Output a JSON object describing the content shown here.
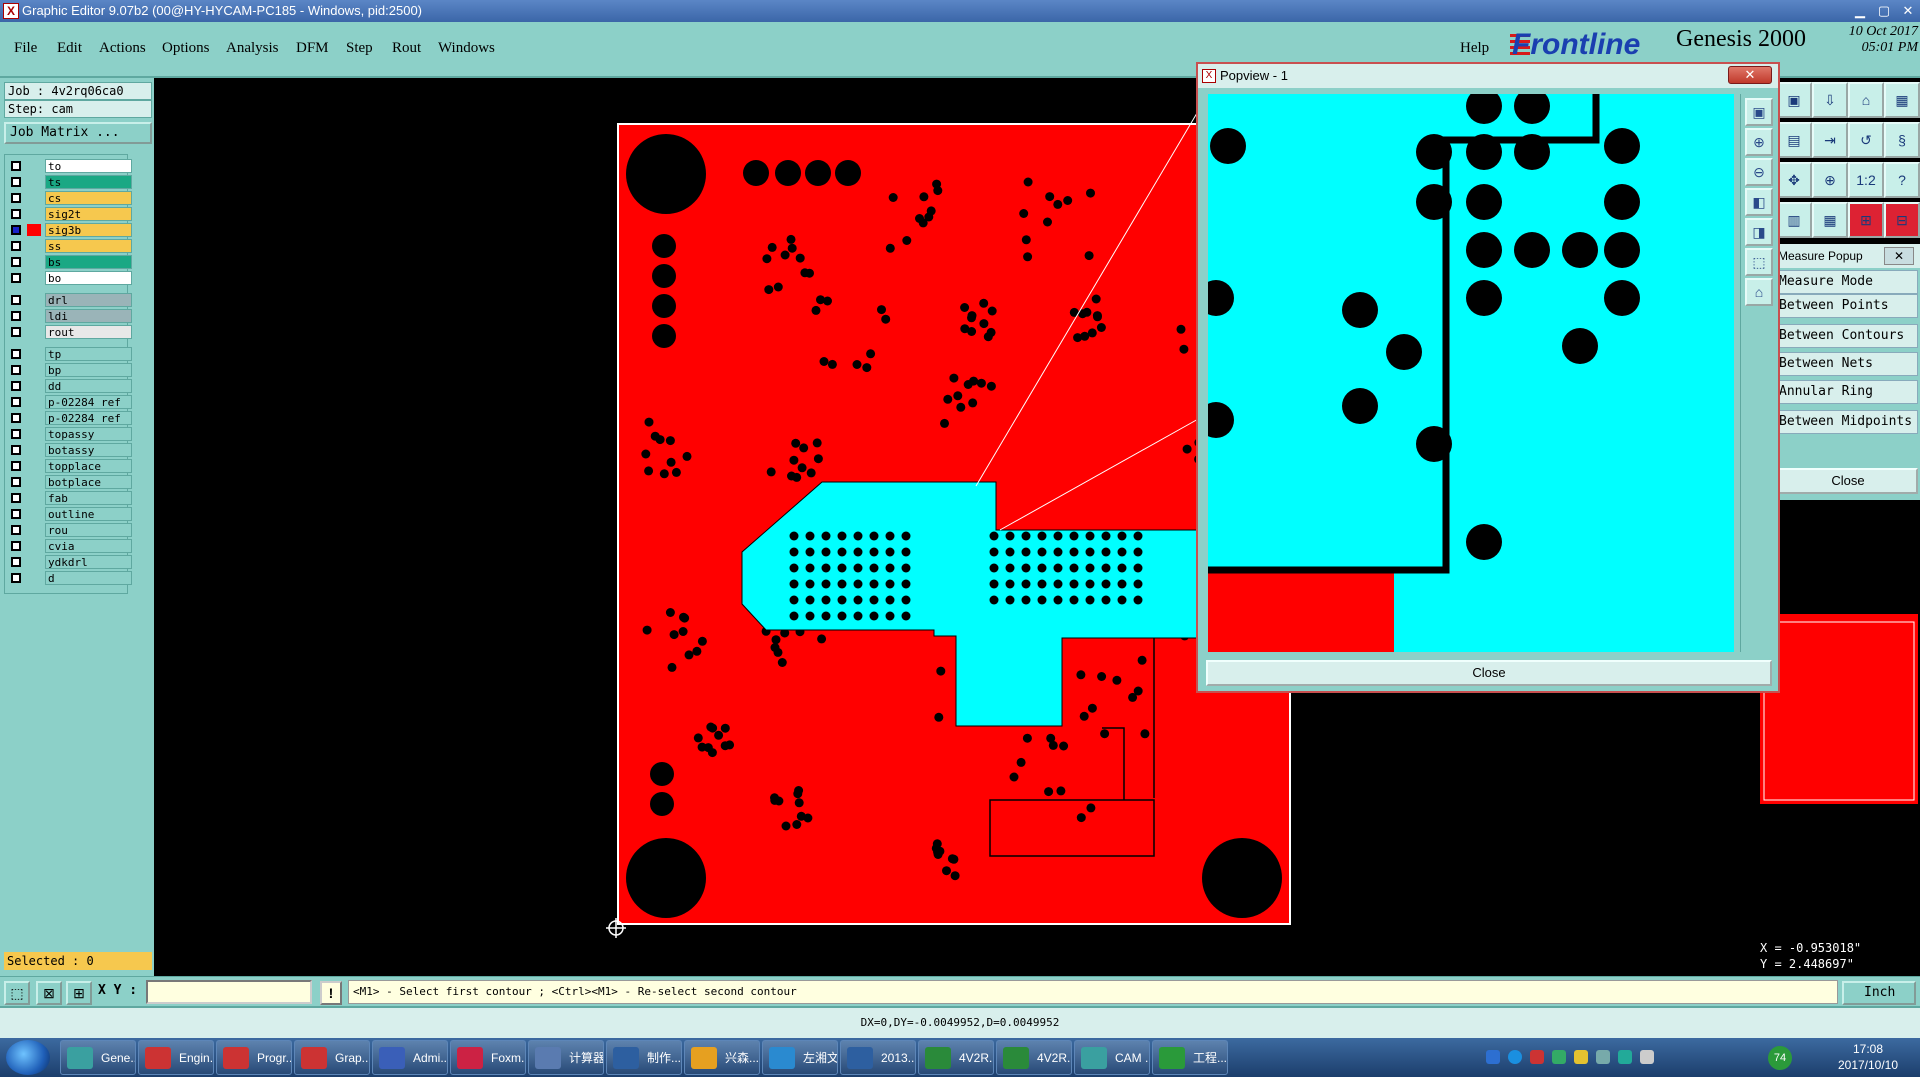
{
  "window": {
    "title": "Graphic Editor 9.07b2 (00@HY-HYCAM-PC185 - Windows, pid:2500)",
    "app_icon": "X",
    "minimize": "▁",
    "maximize": "▢",
    "close": "✕"
  },
  "menu": {
    "items": [
      "File",
      "Edit",
      "Actions",
      "Options",
      "Analysis",
      "DFM",
      "Step",
      "Rout",
      "Windows"
    ],
    "help": "Help"
  },
  "brand": {
    "logo": "Frontline",
    "product": "Genesis 2000",
    "date": "10 Oct 2017",
    "time": "05:01 PM"
  },
  "left_panel": {
    "job": "Job : 4v2rq06ca0",
    "step": "Step: cam",
    "job_matrix": "Job Matrix ...",
    "layers": [
      {
        "name": "to",
        "color": "#ffffff",
        "checked": false
      },
      {
        "name": "ts",
        "color": "#1aa884",
        "checked": false
      },
      {
        "name": "cs",
        "color": "#f6c84e",
        "checked": false
      },
      {
        "name": "sig2t",
        "color": "#f6c84e",
        "checked": false
      },
      {
        "name": "sig3b",
        "color": "#f6c84e",
        "checked": true
      },
      {
        "name": "ss",
        "color": "#f6c84e",
        "checked": false
      },
      {
        "name": "bs",
        "color": "#1aa884",
        "checked": false
      },
      {
        "name": "bo",
        "color": "#ffffff",
        "checked": false
      },
      {
        "name": "drl",
        "color": "#9ab4b8",
        "checked": false
      },
      {
        "name": "ldi",
        "color": "#9ab4b8",
        "checked": false
      },
      {
        "name": "rout",
        "color": "#e8e8e8",
        "checked": false
      },
      {
        "name": "tp",
        "color": "#8cd0c8",
        "checked": false
      },
      {
        "name": "bp",
        "color": "#8cd0c8",
        "checked": false
      },
      {
        "name": "dd",
        "color": "#8cd0c8",
        "checked": false
      },
      {
        "name": "p-02284_ref",
        "color": "#8cd0c8",
        "checked": false
      },
      {
        "name": "p-02284_ref",
        "color": "#8cd0c8",
        "checked": false
      },
      {
        "name": "topassy",
        "color": "#8cd0c8",
        "checked": false
      },
      {
        "name": "botassy",
        "color": "#8cd0c8",
        "checked": false
      },
      {
        "name": "topplace",
        "color": "#8cd0c8",
        "checked": false
      },
      {
        "name": "botplace",
        "color": "#8cd0c8",
        "checked": false
      },
      {
        "name": "fab",
        "color": "#8cd0c8",
        "checked": false
      },
      {
        "name": "outline",
        "color": "#8cd0c8",
        "checked": false
      },
      {
        "name": "rou",
        "color": "#8cd0c8",
        "checked": false
      },
      {
        "name": "cvia",
        "color": "#8cd0c8",
        "checked": false
      },
      {
        "name": "ydkdrl",
        "color": "#8cd0c8",
        "checked": false
      },
      {
        "name": "d",
        "color": "#8cd0c8",
        "checked": false
      }
    ],
    "selected": "Selected : 0"
  },
  "popview": {
    "title": "Popview - 1",
    "close_x": "✕",
    "close_label": "Close",
    "tool_icons": [
      "zoom-fit-icon",
      "zoom-in-icon",
      "zoom-out-icon",
      "pan-left-icon",
      "pan-right-icon",
      "zoom-area-icon",
      "zoom-home-icon"
    ]
  },
  "measure": {
    "title": "Measure Popup",
    "close_x": "✕",
    "items": [
      "Measure Mode",
      "Between Points",
      "Between Contours",
      "Between Nets",
      "Annular Ring",
      "Between Midpoints"
    ],
    "close_label": "Close"
  },
  "right_tools": {
    "row3_label": "1:2",
    "help": "?"
  },
  "status": {
    "xy_label": "X Y :",
    "xy_value": "",
    "excl": "!",
    "prompt": "<M1> - Select first contour ; <Ctrl><M1> - Re-select second contour",
    "unit": "Inch",
    "dx": "DX=0,DY=-0.0049952,D=0.0049952",
    "coord_x": "X = -0.953018\"",
    "coord_y": "Y = 2.448697\""
  },
  "taskbar": {
    "items": [
      "Gene...",
      "Engin...",
      "Progr...",
      "Grap...",
      "Admi...",
      "Foxm...",
      "计算器",
      "制作...",
      "兴森...",
      "左湘文",
      "2013...",
      "4V2R...",
      "4V2R...",
      "CAM ...",
      "工程..."
    ],
    "tray_badge": "74",
    "clock_time": "17:08",
    "clock_date": "2017/10/10"
  },
  "colors": {
    "panel": "#8cd0c8",
    "board_copper": "#ff0000",
    "cyan_fill": "#00ffff",
    "highlight": "#f6c84e"
  }
}
